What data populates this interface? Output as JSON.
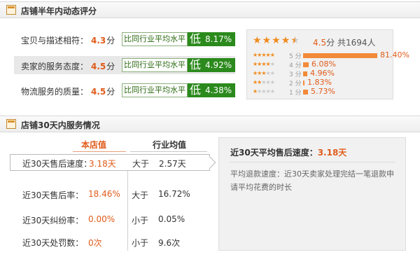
{
  "section1": {
    "title": "店铺半年内动态评分",
    "rows": [
      {
        "label": "宝贝与描述相符：",
        "score": "4.3",
        "unit": "分",
        "compare_label": "比同行业平均水平",
        "level": "低",
        "percent": "8.17%"
      },
      {
        "label": "卖家的服务态度：",
        "score": "4.5",
        "unit": "分",
        "compare_label": "比同行业平均水平",
        "level": "低",
        "percent": "4.92%"
      },
      {
        "label": "物流服务的质量：",
        "score": "4.5",
        "unit": "分",
        "compare_label": "比同行业平均水平",
        "level": "低",
        "percent": "4.38%"
      }
    ],
    "summary": {
      "stars": 4.5,
      "average": "4.5",
      "average_unit": "分",
      "total_text": "共1694人"
    },
    "distribution": [
      {
        "stars": 5,
        "label": "5 分",
        "fraction": 0.814,
        "percent": "81.40%"
      },
      {
        "stars": 4,
        "label": "4 分",
        "fraction": 0.0608,
        "percent": "6.08%"
      },
      {
        "stars": 3,
        "label": "3 分",
        "fraction": 0.0496,
        "percent": "4.96%"
      },
      {
        "stars": 2,
        "label": "2 分",
        "fraction": 0.0183,
        "percent": "1.83%"
      },
      {
        "stars": 1,
        "label": "1 分",
        "fraction": 0.0573,
        "percent": "5.73%"
      }
    ],
    "accent_color": "#e05c1a",
    "low_badge_color": "#2b8a1c"
  },
  "section2": {
    "title": "店铺30天内服务情况",
    "col_mine": "本店值",
    "col_industry": "行业均值",
    "rows": [
      {
        "label": "近30天售后速度：",
        "mine": "3.18天",
        "compare": "大于",
        "industry": "2.57天"
      },
      {
        "label": "近30天售后率：",
        "mine": "18.46%",
        "compare": "大于",
        "industry": "16.72%"
      },
      {
        "label": "近30天纠纷率：",
        "mine": "0.00%",
        "compare": "小于",
        "industry": "0.05%"
      },
      {
        "label": "近30天处罚数：",
        "mine": "0次",
        "compare": "小于",
        "industry": "9.6次"
      }
    ],
    "info": {
      "title": "近30天平均售后速度：",
      "value": "3.18天",
      "description": "平均退款速度：近30天卖家处理完结一笔退款申请平均花费的时长"
    }
  }
}
